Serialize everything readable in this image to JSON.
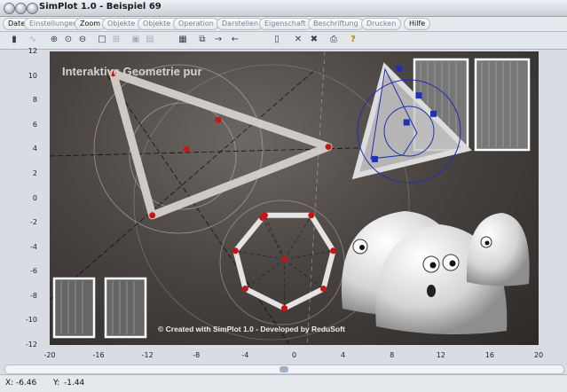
{
  "window": {
    "title": "SimPlot 1.0 - Beispiel 69"
  },
  "menu": {
    "items": [
      "Datei",
      "Einstellungen",
      "Zoom",
      "Objekte I",
      "Objekte II",
      "Operation",
      "Darstellen",
      "Eigenschaft",
      "Beschriftung",
      "Drucken",
      "Hilfe"
    ],
    "enabled": [
      true,
      false,
      true,
      false,
      false,
      false,
      false,
      false,
      false,
      false,
      true
    ]
  },
  "toolbar": {
    "icons": [
      "calculator-icon",
      "function-icon",
      "zoom-in-icon",
      "zoom-reset-icon",
      "zoom-out-icon",
      "frame-icon",
      "grid-icon",
      "snap-icon",
      "window-icon",
      "image-icon",
      "copy-icon",
      "arrow-right-icon",
      "arrow-left-icon",
      "page-icon",
      "delete-icon",
      "delete-all-icon",
      "print-icon",
      "help-icon"
    ]
  },
  "canvas": {
    "title": "Interaktive Geometrie pur",
    "credit": "© Created with SimPlot 1.0 - Developed by ReduSoft"
  },
  "chart_data": {
    "type": "scatter",
    "xlim": [
      -20,
      20
    ],
    "ylim": [
      -12,
      12
    ],
    "x_ticks": [
      "-20",
      "-16",
      "-12",
      "-8",
      "-4",
      "0",
      "4",
      "8",
      "12",
      "16",
      "20"
    ],
    "y_ticks": [
      "12",
      "10",
      "8",
      "6",
      "4",
      "2",
      "0",
      "-2",
      "-4",
      "-6",
      "-8",
      "-10",
      "-12"
    ],
    "triangle": [
      [
        -14.8,
        10.2
      ],
      [
        -11.6,
        -1.4
      ],
      [
        2.8,
        4.2
      ]
    ],
    "triangle_center": [
      -8.8,
      4
    ],
    "triangle_extra_point": [
      -6.2,
      6.4
    ],
    "octagon_center": [
      -0.8,
      -5
    ],
    "octagon": [
      [
        -2.4,
        -1.4
      ],
      [
        1.4,
        -1.4
      ],
      [
        3.2,
        -4.3
      ],
      [
        2.4,
        -7.4
      ],
      [
        -0.8,
        -9
      ],
      [
        -4,
        -7.4
      ],
      [
        -4.8,
        -4.3
      ],
      [
        -2.6,
        -1.6
      ]
    ],
    "blue_points": [
      [
        8.6,
        10.6
      ],
      [
        10.2,
        8.4
      ],
      [
        9.2,
        6.2
      ],
      [
        6.6,
        3.2
      ],
      [
        11.4,
        6.9
      ]
    ]
  },
  "status": {
    "x_label": "X:",
    "x_value": "-6.46",
    "y_label": "Y:",
    "y_value": "-1.44"
  },
  "colors": {
    "canvas_bg": "#4a4542",
    "triangle_fill": "#d7d4d0",
    "point_red": "#c81414",
    "point_blue": "#1f2fb8"
  }
}
